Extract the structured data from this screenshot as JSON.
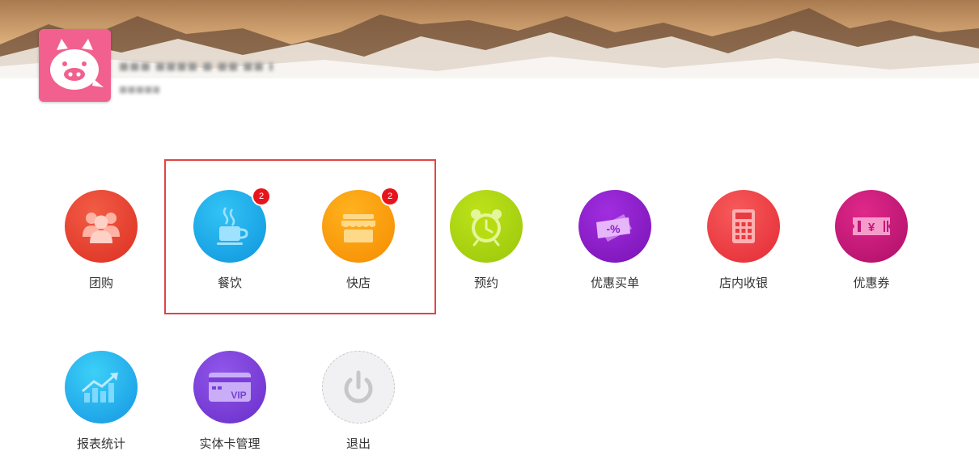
{
  "header": {
    "store_name": "■■■ ■■■■ ■ ■■ ■■ ■ ■",
    "store_sub": "■■■■■"
  },
  "menu": {
    "row1": [
      {
        "label": "团购",
        "icon": "group-people-icon",
        "color": "#e8412e"
      },
      {
        "label": "餐饮",
        "icon": "coffee-cup-icon",
        "color": "#1aa5e8",
        "badge": "2"
      },
      {
        "label": "快店",
        "icon": "storefront-icon",
        "color": "#fb9a05",
        "badge": "2"
      },
      {
        "label": "预约",
        "icon": "alarm-clock-icon",
        "color": "#a3cf0d"
      },
      {
        "label": "优惠买单",
        "icon": "discount-ticket-icon",
        "color": "#8a1fc4"
      },
      {
        "label": "店内收银",
        "icon": "calculator-icon",
        "color": "#ee3a43"
      },
      {
        "label": "优惠券",
        "icon": "yen-coupon-icon",
        "color": "#c4157a"
      }
    ],
    "row2": [
      {
        "label": "报表统计",
        "icon": "trend-chart-icon",
        "color": "#1fb3ef"
      },
      {
        "label": "实体卡管理",
        "icon": "vip-card-icon",
        "color": "#7a3fd8"
      },
      {
        "label": "退出",
        "icon": "power-icon",
        "color": "#f0f0f2"
      }
    ]
  }
}
